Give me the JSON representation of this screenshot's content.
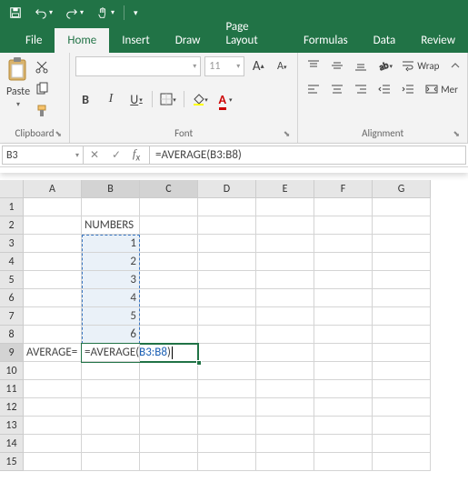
{
  "titlebar": {
    "save": "Save",
    "undo": "Undo",
    "redo": "Redo",
    "touch": "Touch/Mouse Mode"
  },
  "tabs": {
    "file": "File",
    "home": "Home",
    "insert": "Insert",
    "draw": "Draw",
    "page_layout": "Page Layout",
    "formulas": "Formulas",
    "data": "Data",
    "review": "Review"
  },
  "ribbon": {
    "clipboard": {
      "paste": "Paste",
      "label": "Clipboard"
    },
    "font": {
      "name_placeholder": "",
      "size_placeholder": "11",
      "bold": "B",
      "italic": "I",
      "underline": "U",
      "increase": "A",
      "decrease": "A",
      "label": "Font"
    },
    "alignment": {
      "wrap": "Wrap",
      "merge": "Mer",
      "label": "Alignment"
    }
  },
  "formula_bar": {
    "name_box": "B3",
    "formula_raw": "=AVERAGE(B3:B8)",
    "formula_prefix": "=AVERAGE(",
    "formula_ref": "B3:B8",
    "formula_suffix": ")"
  },
  "sheet": {
    "columns": [
      "A",
      "B",
      "C",
      "D",
      "E",
      "F",
      "G"
    ],
    "rows": [
      "1",
      "2",
      "3",
      "4",
      "5",
      "6",
      "7",
      "8",
      "9",
      "10",
      "11",
      "12",
      "13",
      "14",
      "15"
    ],
    "cells": {
      "A9": "AVERAGE=",
      "B2": "NUMBERS",
      "B3": "1",
      "B4": "2",
      "B5": "3",
      "B6": "4",
      "B7": "5",
      "B8": "6"
    },
    "editing_cell": "B9"
  },
  "chart_data": {
    "type": "table",
    "title": "NUMBERS",
    "values": [
      1,
      2,
      3,
      4,
      5,
      6
    ],
    "formula": "=AVERAGE(B3:B8)"
  }
}
